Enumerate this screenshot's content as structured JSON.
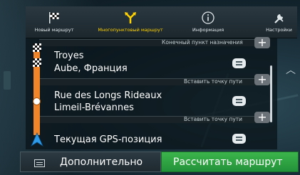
{
  "toolbar": {
    "items": [
      {
        "label": "Новый маршрут",
        "icon": "checkered-flag-icon"
      },
      {
        "label": "Многопунктовый маршрут",
        "icon": "multipoint-route-icon",
        "active": true
      },
      {
        "label": "Информация",
        "icon": "info-icon"
      },
      {
        "label": "Настройки",
        "icon": "tools-icon"
      }
    ]
  },
  "route": {
    "destination_label": "Конечный пункт назначения",
    "insert_waypoint_label": "Вставить точку пути",
    "waypoints": [
      {
        "line1": "Troyes",
        "line2": "Aube, Франция",
        "icon": "checkered-flag-icon"
      },
      {
        "line1": "Rue des Longs Rideaux",
        "line2": "Limeil-Brévannes",
        "icon": "waypoint-dot-icon"
      },
      {
        "line1": "Текущая GPS-позиция",
        "line2": "",
        "icon": "gps-arrow-icon"
      }
    ]
  },
  "buttons": {
    "more": "Дополнительно",
    "calculate": "Рассчитать маршрут"
  },
  "colors": {
    "accent": "#ffd200",
    "route_rail": "#f0852a",
    "calculate_button": "#2ea643"
  }
}
